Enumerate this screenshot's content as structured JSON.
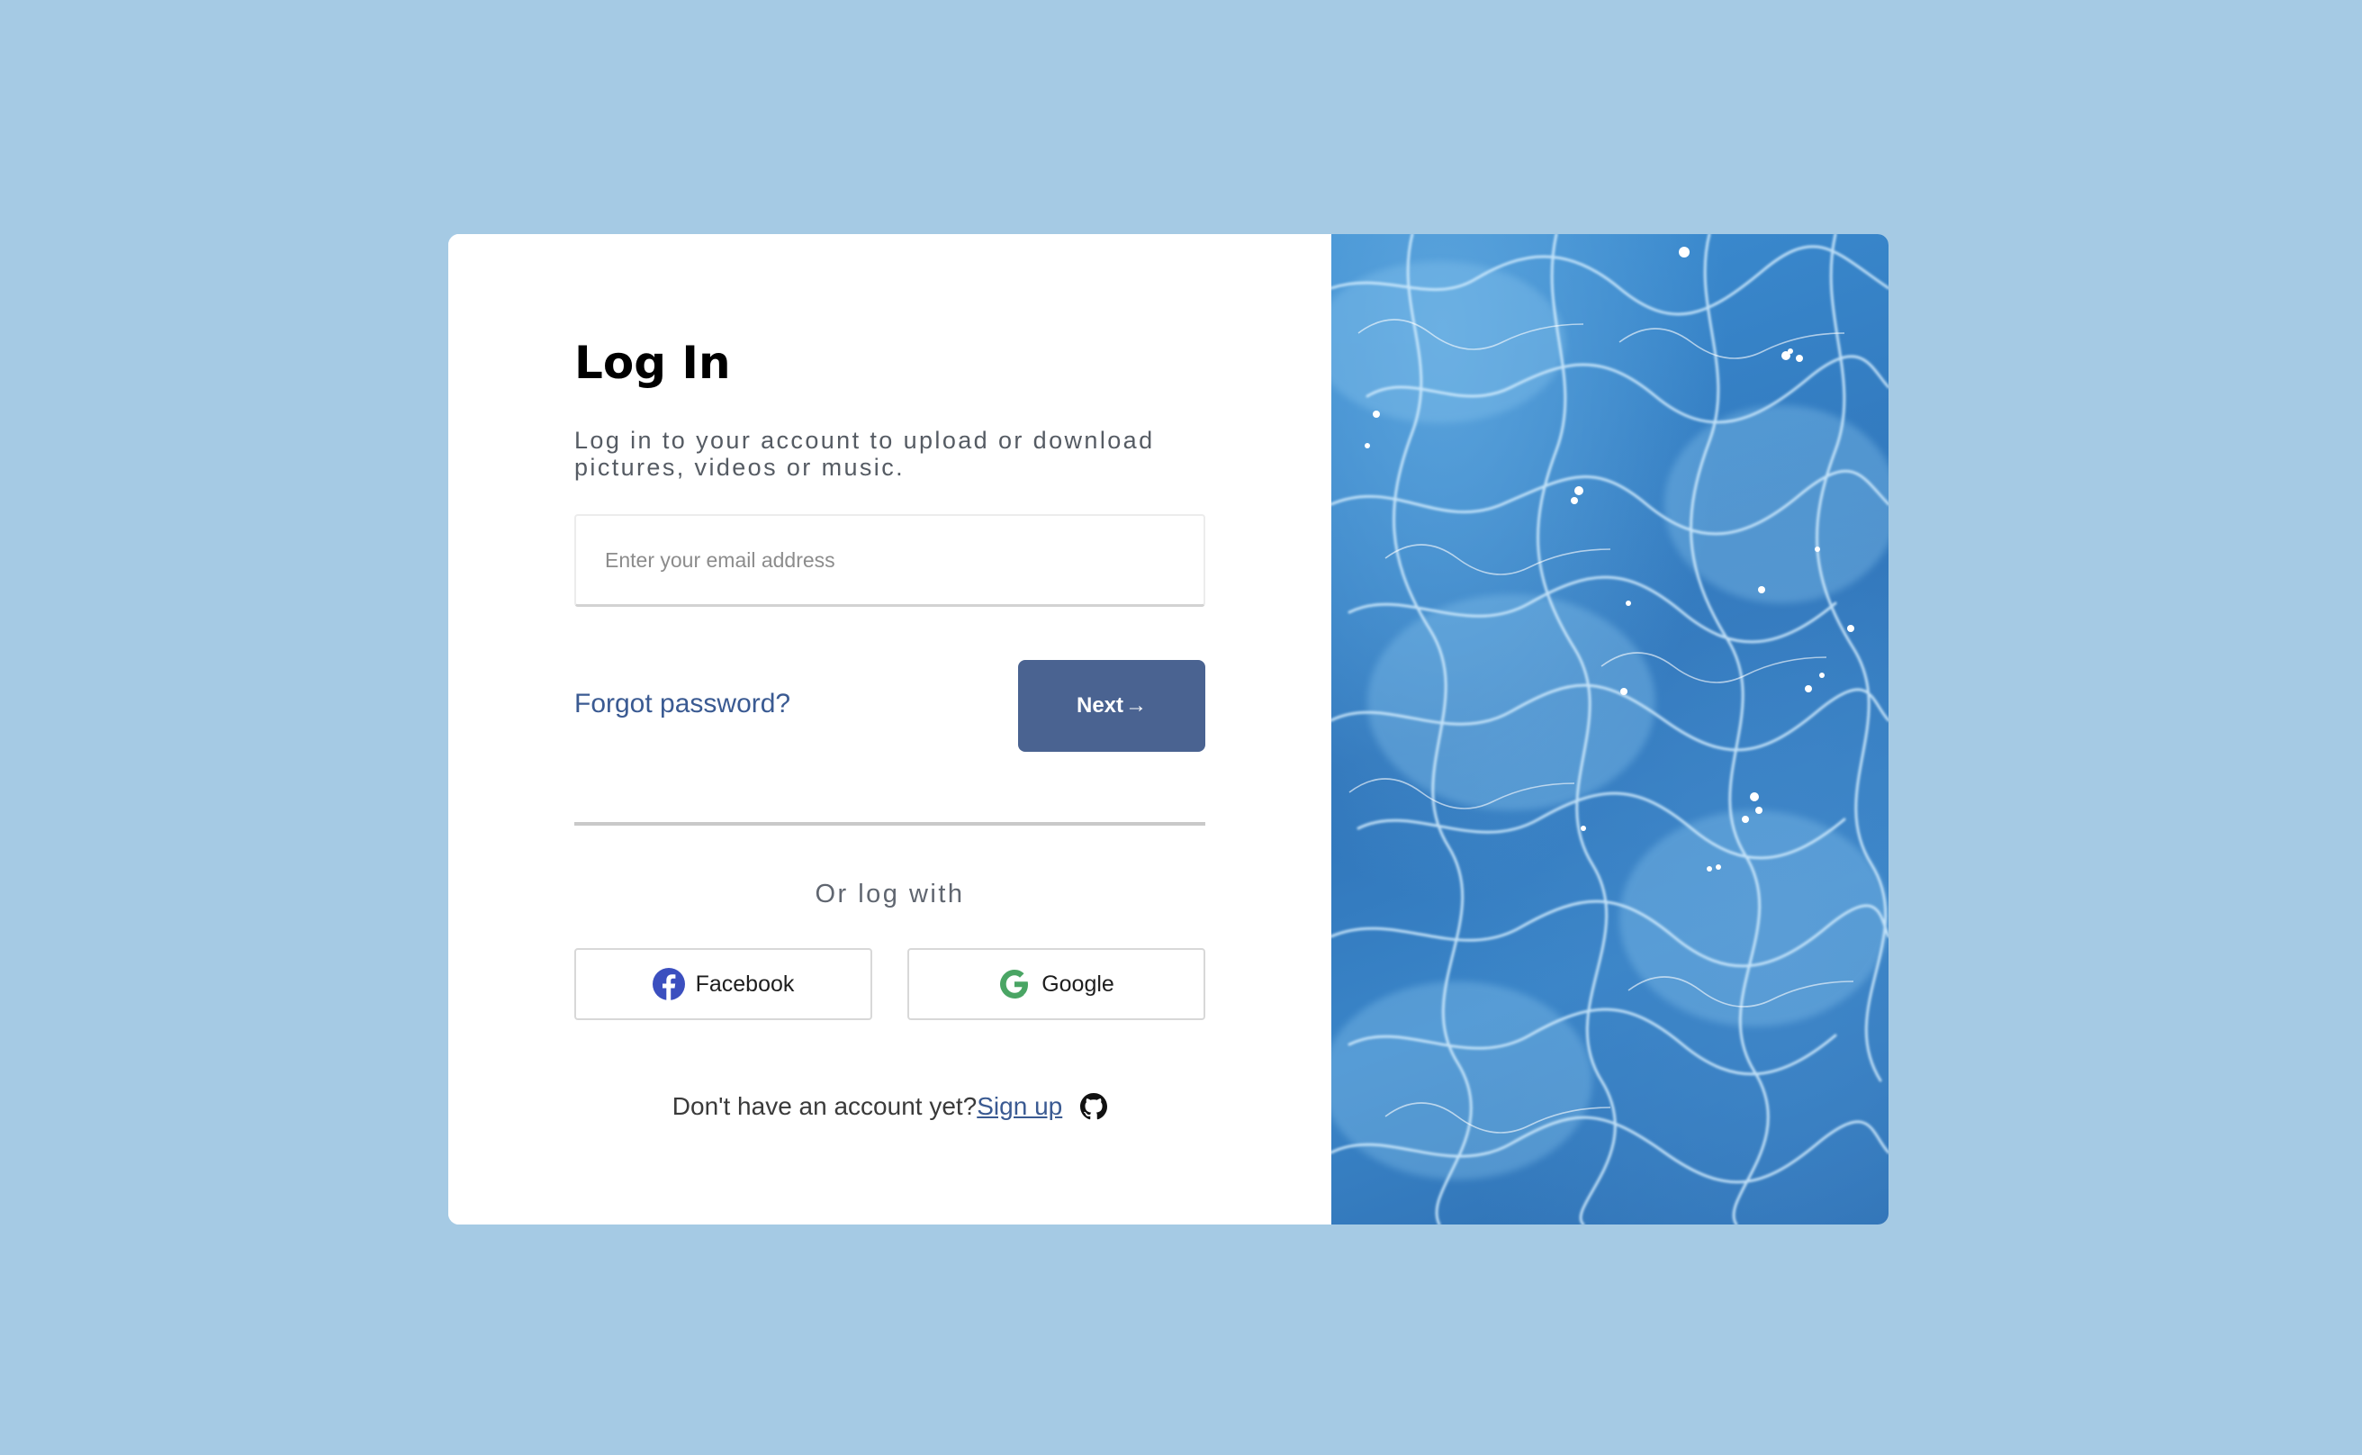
{
  "login": {
    "title": "Log In",
    "subtitle": "Log in to your account to upload or download pictures, videos or music.",
    "email_placeholder": "Enter your email address",
    "email_value": "",
    "forgot_password": "Forgot password?",
    "next_button": "Next",
    "next_icon": "arrow-right-icon",
    "or_log_with": "Or log with",
    "social": [
      {
        "label": "Facebook",
        "icon": "facebook-icon",
        "color": "#3b4fbf"
      },
      {
        "label": "Google",
        "icon": "google-icon",
        "color": "#4aa564"
      }
    ],
    "no_account_text": "Don't have an account yet?",
    "sign_up": "Sign up",
    "github_icon": "github-icon"
  },
  "colors": {
    "background": "#a5cae4",
    "accent": "#4a6391",
    "link": "#3a5a92"
  },
  "image_panel": {
    "description_icon": "water-caustics-image"
  }
}
